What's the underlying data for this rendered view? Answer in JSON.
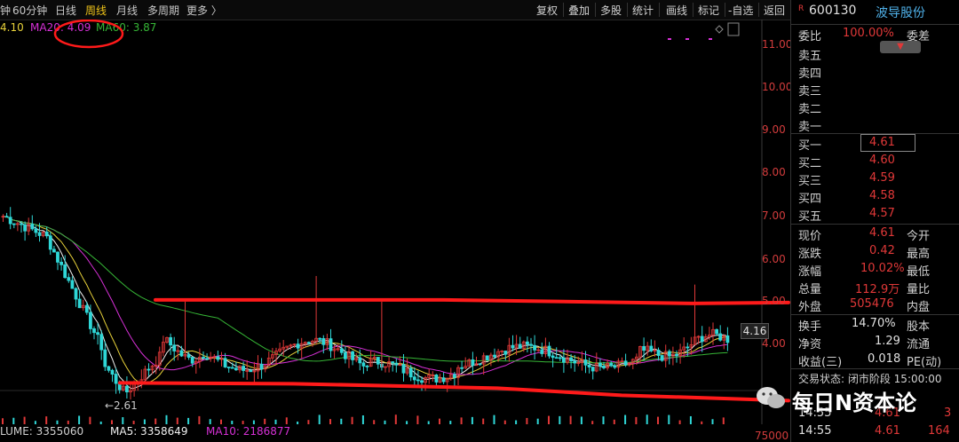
{
  "period_bar": {
    "items": [
      "钟",
      "60分钟",
      "日线",
      "周线",
      "月线",
      "多周期",
      "更多 〉"
    ],
    "active": "周线"
  },
  "toolbar": {
    "items": [
      "复权",
      "叠加",
      "多股",
      "统计",
      "画线",
      "标记",
      "-自选",
      "返回"
    ]
  },
  "ma_legend": {
    "ma10": "4.10",
    "ma20": "MA20: 4.09",
    "ma60": "MA60: 3.87"
  },
  "volume_legend": {
    "volume": "LUME: 3355060",
    "ma5": "MA5: 3358649",
    "ma10": "MA10: 2186877"
  },
  "volume_axis_tick": "75000",
  "low_price_label": "←2.61",
  "current_price_tag": "4.16",
  "chart_data": {
    "type": "candlestick",
    "y_ticks": [
      "11.00",
      "10.00",
      "9.00",
      "8.00",
      "7.00",
      "6.00",
      "5.00",
      "4.00"
    ],
    "ylim": [
      3.0,
      11.5
    ],
    "annotated_low": 2.61,
    "resistance_line": 5.0,
    "support_line": 3.1
  },
  "stock": {
    "mark": "R",
    "code": "600130",
    "name": "波导股份"
  },
  "order_book": {
    "weibi_label": "委比",
    "weibi_value": "100.00%",
    "weicha_label": "委差",
    "sell": [
      {
        "label": "卖五",
        "price": ""
      },
      {
        "label": "卖四",
        "price": ""
      },
      {
        "label": "卖三",
        "price": ""
      },
      {
        "label": "卖二",
        "price": ""
      },
      {
        "label": "卖一",
        "price": ""
      }
    ],
    "buy": [
      {
        "label": "买一",
        "price": "4.61"
      },
      {
        "label": "买二",
        "price": "4.60"
      },
      {
        "label": "买三",
        "price": "4.59"
      },
      {
        "label": "买四",
        "price": "4.58"
      },
      {
        "label": "买五",
        "price": "4.57"
      }
    ]
  },
  "quote": [
    {
      "label": "现价",
      "value": "4.61",
      "label2": "今开"
    },
    {
      "label": "涨跌",
      "value": "0.42",
      "label2": "最高"
    },
    {
      "label": "涨幅",
      "value": "10.02%",
      "label2": "最低"
    },
    {
      "label": "总量",
      "value": "112.9万",
      "label2": "量比"
    },
    {
      "label": "外盘",
      "value": "505476",
      "label2": "内盘"
    }
  ],
  "fundamentals": [
    {
      "label": "换手",
      "value": "14.70%",
      "label2": "股本"
    },
    {
      "label": "净资",
      "value": "1.29",
      "label2": "流通"
    },
    {
      "label": "收益(三)",
      "value": "0.018",
      "label2": "PE(动)"
    }
  ],
  "trade_status": "交易状态: 闭市阶段 15:00:00",
  "ticks": [
    {
      "time": "14:55",
      "price": "4.61",
      "vol": "3"
    },
    {
      "time": "14:55",
      "price": "4.61",
      "vol": "164"
    }
  ],
  "watermark": "每日N资本论",
  "colors": {
    "up": "#e03838",
    "down": "#2fd7d7",
    "ma5": "#f0f0f0",
    "ma10": "#e8d23a",
    "ma20": "#d630d6",
    "ma60": "#36b636",
    "annotation": "#ff1a1a"
  }
}
